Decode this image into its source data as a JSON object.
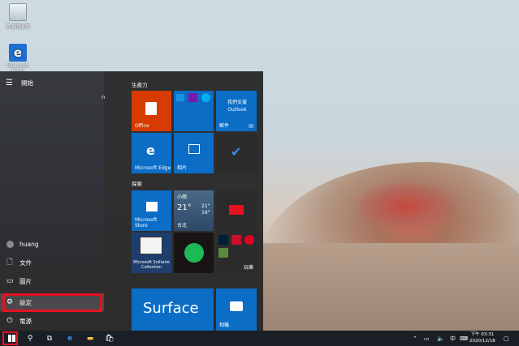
{
  "desktop": {
    "icons": [
      {
        "label": "資源回收筒"
      },
      {
        "label": "Microsoft Edge"
      }
    ]
  },
  "start_menu": {
    "title": "開始",
    "user": "huang",
    "items": [
      {
        "label": "文件"
      },
      {
        "label": "圖片"
      },
      {
        "label": "設定"
      },
      {
        "label": "電源"
      }
    ],
    "cut_text": "n",
    "groups": [
      {
        "label": "生產力"
      },
      {
        "label": "探索"
      }
    ],
    "tiles": {
      "office": "Office",
      "mail_title": "我們支援 Outlook",
      "mail_label": "郵件",
      "edge": "Microsoft Edge",
      "photos": "相片",
      "store": "Microsoft Store",
      "weather_city": "小雨",
      "weather_temp": "21°",
      "weather_hi": "21°",
      "weather_lo": "16°",
      "weather_loc": "台北",
      "solitaire": "Microsoft Solitaire Collection",
      "play": "玩樂",
      "surface": "Surface",
      "camera": "相機"
    }
  },
  "taskbar": {
    "ime": "中",
    "time": "下午 03:31",
    "date": "2020/12/18"
  }
}
